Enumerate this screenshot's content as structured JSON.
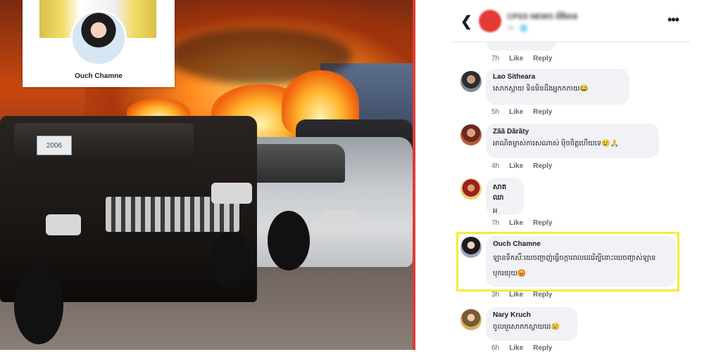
{
  "photo": {
    "plate_text": "2006",
    "profile_name": "Ouch Chamne"
  },
  "header": {
    "page_name": "CPSS NEWS ព័ត៌មាន",
    "page_sub": "7h · 🌐"
  },
  "comments": [
    {
      "name": "",
      "text": "",
      "time": "7h",
      "like": "Like",
      "reply": "Reply"
    },
    {
      "name": "Lao Sitheara",
      "text": "សោកស្ដាយ ទិនមិនដឹងអ្នកកកាយ😂",
      "time": "5h",
      "like": "Like",
      "reply": "Reply"
    },
    {
      "name": "Zãã Dãrãty",
      "text": "អាណិតម្ចាស់ការសណាស់ ម៉ិចចិត្តហើយទេ😢🙏",
      "time": "4h",
      "like": "Like",
      "reply": "Reply"
    },
    {
      "name": "សាត ឈា",
      "text": "អ",
      "time": "7h",
      "like": "Like",
      "reply": "Reply"
    },
    {
      "name": "Ouch Chamne",
      "text": "ឡានទីកសិ៍ៈយេចញ្ជាញ់ធ្វើចក្កាពេលដេរើត្បីនោះយេចញ្ជាស់ឡាន បុករយុយ😡",
      "time": "3h",
      "like": "Like",
      "reply": "Reply"
    },
    {
      "name": "Nary Kruch",
      "text": "ចូលមួសោភកស្ដាយដេ😢",
      "time": "6h",
      "like": "Like",
      "reply": "Reply"
    }
  ],
  "colors": {
    "divider": "#e53935",
    "highlight": "#f7ea3b",
    "bubble": "#f0f2f5"
  },
  "icons": {
    "back": "chevron-left-icon",
    "more": "more-horizontal-icon"
  }
}
